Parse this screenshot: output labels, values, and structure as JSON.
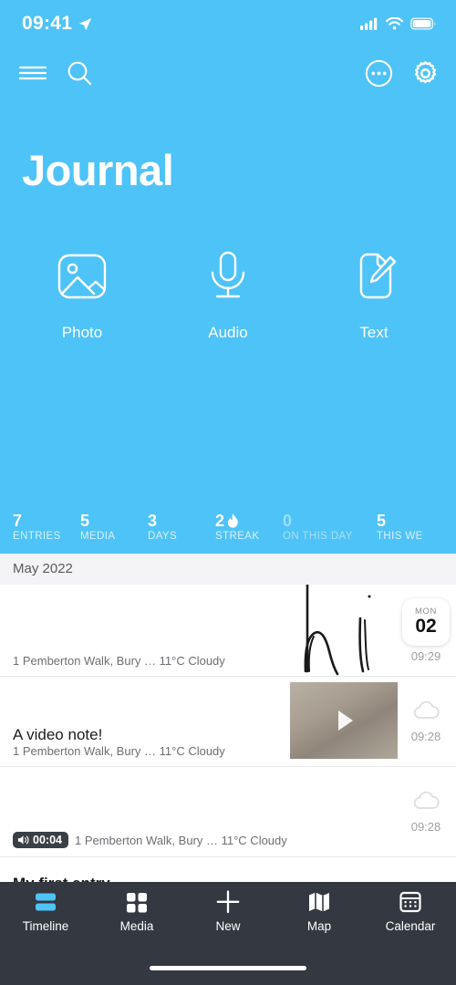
{
  "status_bar": {
    "time": "09:41",
    "location_icon": "location-arrow-icon",
    "signal_icon": "cellular-signal-icon",
    "wifi_icon": "wifi-icon",
    "battery_icon": "battery-icon"
  },
  "nav": {
    "menu_icon": "hamburger-menu-icon",
    "search_icon": "search-icon",
    "more_icon": "ellipsis-circle-icon",
    "settings_icon": "gear-icon"
  },
  "header": {
    "title": "Journal"
  },
  "quick_actions": [
    {
      "label": "Photo",
      "icon": "photo-icon"
    },
    {
      "label": "Audio",
      "icon": "microphone-icon"
    },
    {
      "label": "Text",
      "icon": "document-pencil-icon"
    }
  ],
  "stats": [
    {
      "value": "7",
      "label": "ENTRIES",
      "dim": false,
      "icon": ""
    },
    {
      "value": "5",
      "label": "MEDIA",
      "dim": false,
      "icon": ""
    },
    {
      "value": "3",
      "label": "DAYS",
      "dim": false,
      "icon": ""
    },
    {
      "value": "2",
      "label": "STREAK",
      "dim": false,
      "icon": "flame-icon"
    },
    {
      "value": "0",
      "label": "ON THIS DAY",
      "dim": true,
      "icon": ""
    },
    {
      "value": "5",
      "label": "THIS WE",
      "dim": false,
      "icon": ""
    }
  ],
  "timeline": {
    "month_header": "May 2022",
    "entries": [
      {
        "title": "",
        "meta": "1 Pemberton Walk, Bury … 11°C Cloudy",
        "time": "09:29",
        "thumb": "sketch",
        "badge": {
          "dow": "MON",
          "day": "02"
        },
        "weather_icon": ""
      },
      {
        "title": "A video note!",
        "meta": "1 Pemberton Walk, Bury … 11°C Cloudy",
        "time": "09:28",
        "thumb": "video",
        "badge": null,
        "weather_icon": "cloud-icon"
      },
      {
        "title": "",
        "meta": "1 Pemberton Walk, Bury … 11°C Cloudy",
        "time": "09:28",
        "thumb": "none",
        "badge": null,
        "weather_icon": "cloud-icon",
        "audio_duration": "00:04"
      },
      {
        "title": "My first entry",
        "meta": "",
        "time": "",
        "thumb": "none",
        "badge": null,
        "weather_icon": ""
      }
    ]
  },
  "tabs": [
    {
      "label": "Timeline",
      "icon": "timeline-icon",
      "active": true
    },
    {
      "label": "Media",
      "icon": "grid-icon",
      "active": false
    },
    {
      "label": "New",
      "icon": "plus-icon",
      "active": false
    },
    {
      "label": "Map",
      "icon": "map-icon",
      "active": false
    },
    {
      "label": "Calendar",
      "icon": "calendar-icon",
      "active": false
    }
  ],
  "colors": {
    "brand": "#4ec3f7",
    "tabbar": "#343841",
    "accent": "#4ec3f7"
  }
}
